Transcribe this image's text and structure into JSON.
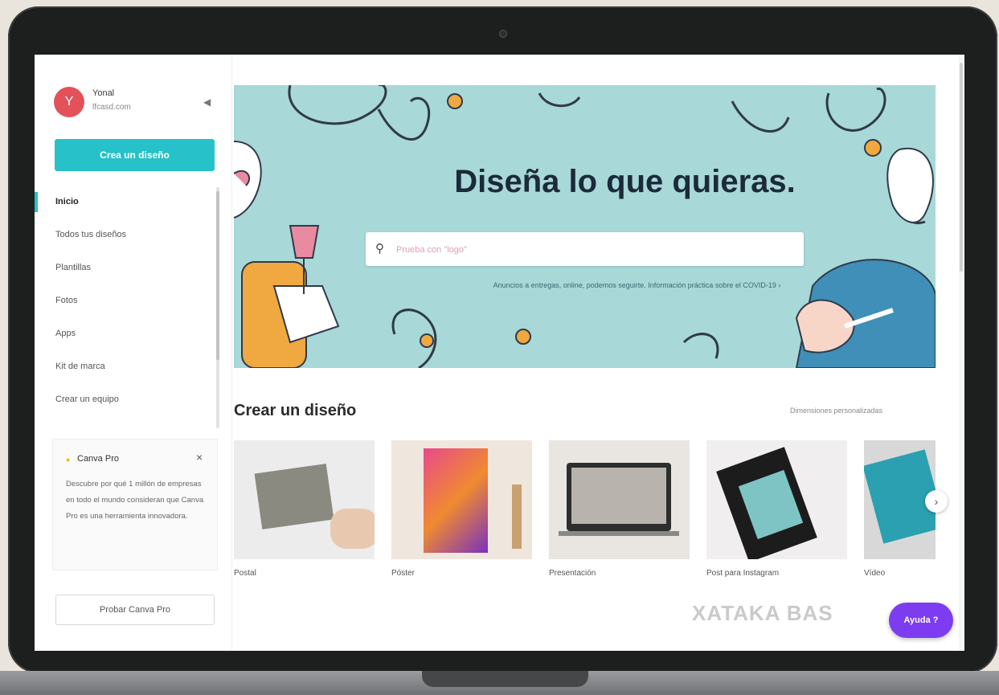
{
  "user": {
    "initial": "Y",
    "name": "Yonal",
    "email": "lfcasd.com"
  },
  "sidebar": {
    "create_label": "Crea un diseño",
    "items": [
      {
        "label": "Inicio",
        "active": true
      },
      {
        "label": "Todos tus diseños"
      },
      {
        "label": "Plantillas"
      },
      {
        "label": "Fotos"
      },
      {
        "label": "Apps"
      },
      {
        "label": "Kit de marca"
      },
      {
        "label": "Crear un equipo"
      }
    ],
    "pro_card": {
      "title": "Canva Pro",
      "text": "Descubre por qué 1 millón de empresas en todo el mundo consideran que Canva Pro es una herramienta innovadora."
    },
    "trial_label": "Probar Canva Pro"
  },
  "hero": {
    "title": "Diseña lo que quieras.",
    "search_placeholder": "Prueba con \"logo\"",
    "hint": "Anuncios a entregas, online, podemos seguirte. Información práctica sobre el COVID-19 ›"
  },
  "section": {
    "title": "Crear un diseño",
    "link": "Dimensiones personalizadas"
  },
  "cards": [
    {
      "label": "Postal"
    },
    {
      "label": "Póster"
    },
    {
      "label": "Presentación"
    },
    {
      "label": "Post para Instagram"
    },
    {
      "label": "Vídeo"
    }
  ],
  "watermark": "XATAKA BAS",
  "help_label": "Ayuda ?",
  "colors": {
    "accent": "#26c1c9",
    "hero_bg": "#a8d8d8",
    "help": "#7d3cf0",
    "avatar": "#e3515b"
  }
}
